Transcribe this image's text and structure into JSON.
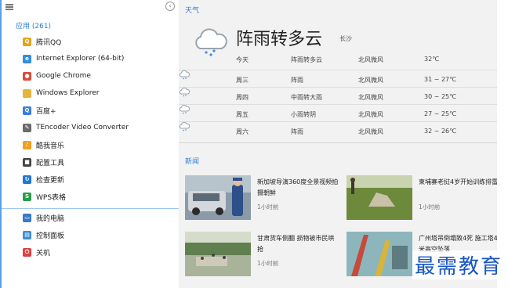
{
  "menu": {
    "apps_header": "应用 (261)",
    "collapse_glyph": "‹",
    "apps": [
      {
        "label": "腾讯QQ",
        "icon": "qq-icon",
        "color": "#e8a313",
        "glyph": "Q"
      },
      {
        "label": "Internet Explorer (64-bit)",
        "icon": "ie-icon",
        "color": "#2f8fe0",
        "glyph": "e"
      },
      {
        "label": "Google Chrome",
        "icon": "chrome-icon",
        "color": "#dd4b39",
        "glyph": "●"
      },
      {
        "label": "Windows Explorer",
        "icon": "folder-icon",
        "color": "#e4b53a",
        "glyph": ""
      },
      {
        "label": "百度+",
        "icon": "baidu-search-icon",
        "color": "#3b7de0",
        "glyph": "Q"
      },
      {
        "label": "TEncoder Video Converter",
        "icon": "tencoder-icon",
        "color": "#6a6a6a",
        "glyph": "✎"
      },
      {
        "label": "酷我音乐",
        "icon": "kuwo-music-icon",
        "color": "#f0a020",
        "glyph": "♪"
      },
      {
        "label": "配置工具",
        "icon": "config-tool-icon",
        "color": "#444444",
        "glyph": "■"
      },
      {
        "label": "检查更新",
        "icon": "update-icon",
        "color": "#1e78d7",
        "glyph": "↻"
      },
      {
        "label": "WPS表格",
        "icon": "wps-sheet-icon",
        "color": "#2a9d4a",
        "glyph": "S"
      }
    ],
    "system": [
      {
        "label": "我的电脑",
        "icon": "computer-icon",
        "color": "#3a78c8",
        "glyph": "▭"
      },
      {
        "label": "控制面板",
        "icon": "control-panel-icon",
        "color": "#3a8fd0",
        "glyph": "▤"
      },
      {
        "label": "关机",
        "icon": "power-icon",
        "color": "#e04040",
        "glyph": "⏻"
      }
    ]
  },
  "weather": {
    "section_label": "天气",
    "condition": "阵雨转多云",
    "city": "长沙",
    "today": {
      "day": "今天",
      "cond": "阵雨转多云",
      "wind": "北风微风",
      "temp": "32℃"
    },
    "forecast": [
      {
        "day": "周三",
        "cond": "阵雨",
        "wind": "北风微风",
        "temp": "31 ~ 27℃"
      },
      {
        "day": "周四",
        "cond": "中雨转大雨",
        "wind": "北风微风",
        "temp": "30 ~ 25℃"
      },
      {
        "day": "周五",
        "cond": "小雨转阴",
        "wind": "北风微风",
        "temp": "27 ~ 25℃"
      },
      {
        "day": "周六",
        "cond": "阵雨",
        "wind": "北风微风",
        "temp": "32 ~ 26℃"
      }
    ]
  },
  "news": {
    "section_label": "新闻",
    "items": [
      {
        "title": "新加坡导演360度全景视频拍摄朝鲜",
        "time": "1小时前"
      },
      {
        "title": "柬埔寨老挝4岁开始训练排雷",
        "time": "1小时前"
      },
      {
        "title": "甘肃货车侧翻 损物被市民哄抢",
        "time": "1小时前"
      },
      {
        "title": "广州塔吊倒塌致4死 施工塔40米高空坠落",
        "time": ""
      }
    ]
  },
  "watermark": "最需教育"
}
